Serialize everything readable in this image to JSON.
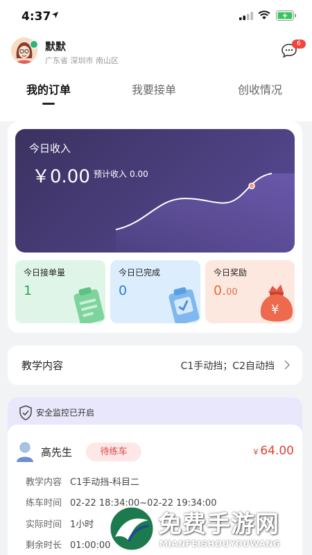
{
  "status_bar": {
    "time": "4:37"
  },
  "header": {
    "user_name": "默默",
    "location": "广东省  深圳市  南山区",
    "message_badge": "6"
  },
  "tabs": [
    {
      "label": "我的订单",
      "active": true
    },
    {
      "label": "我要接单",
      "active": false
    },
    {
      "label": "创收情况",
      "active": false
    }
  ],
  "income": {
    "label": "今日收入",
    "amount": "￥0.00",
    "estimate_label": "预计收入",
    "estimate_value": "0.00"
  },
  "stats": [
    {
      "title": "今日接单量",
      "value": "1",
      "icon": "clipboard-icon"
    },
    {
      "title": "今日已完成",
      "value": "0",
      "icon": "checked-clipboard-icon"
    },
    {
      "title": "今日奖励",
      "value_main": "0.",
      "value_small": "00",
      "icon": "money-bag-icon"
    }
  ],
  "teaching": {
    "label": "教学内容",
    "value": "C1手动挡；C2自动挡"
  },
  "security": {
    "text": "安全监控已开启"
  },
  "order": {
    "name": "高先生",
    "tag": "待练车",
    "currency": "￥",
    "price": "64.00",
    "rows": [
      {
        "key": "教学内容",
        "value": "C1手动挡-科目二"
      },
      {
        "key": "练车时间",
        "value": "02-22 18:34:00~02-22 19:34:00"
      },
      {
        "key": "实际时间",
        "value": "1小时"
      },
      {
        "key": "剩余时长",
        "value": "01:00:00"
      }
    ]
  },
  "watermark": {
    "title": "免费手游网",
    "subtitle": "MIANFEISHOUYOUWANG"
  },
  "colors": {
    "income_card": "#4b3f7d",
    "accent_red": "#e0402f",
    "green": "#29a55c",
    "blue": "#2f7fd8",
    "orange": "#e46f43"
  }
}
